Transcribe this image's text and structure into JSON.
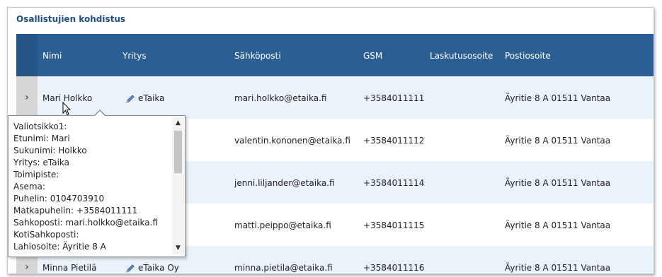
{
  "panel": {
    "title": "Osallistujien kohdistus"
  },
  "columns": [
    "Nimi",
    "Yritys",
    "Sähköposti",
    "GSM",
    "Laskutusosoite",
    "Postiosoite"
  ],
  "rows": [
    {
      "name": "Mari Holkko",
      "company": "eTaika",
      "email": "mari.holkko@etaika.fi",
      "gsm": "+3584011111",
      "billing": "",
      "postal": "Äyritie 8 A 01511 Vantaa"
    },
    {
      "name": "",
      "company": "",
      "email": "valentin.kononen@etaika.fi",
      "gsm": "+3584011112",
      "billing": "",
      "postal": "Äyritie 8 A 01511 Vantaa"
    },
    {
      "name": "",
      "company": "",
      "email": "jenni.liljander@etaika.fi",
      "gsm": "+3584011114",
      "billing": "",
      "postal": "Äyritie 8 A 01511 Vantaa"
    },
    {
      "name": "",
      "company": "",
      "email": "matti.peippo@etaika.fi",
      "gsm": "+3584011115",
      "billing": "",
      "postal": "Äyritie 8 A 01511 Vantaa"
    },
    {
      "name": "Minna Pietilä",
      "company": "eTaika Oy",
      "email": "minna.pietila@etaika.fi",
      "gsm": "+3584011116",
      "billing": "",
      "postal": "Äyritie 8 A 01511 Vantaa"
    }
  ],
  "expander_icon": "›",
  "tooltip": {
    "lines": [
      "Valiotsikko1:",
      "Etunimi: Mari",
      "Sukunimi: Holkko",
      "Yritys: eTaika",
      "Toimipiste:",
      "Asema:",
      "Puhelin: 0104703910",
      "Matkapuhelin: +3584011111",
      "Sahkoposti: mari.holkko@etaika.fi",
      "KotiSahkoposti:",
      "Lahiosoite: Äyritie 8 A"
    ],
    "scroll_up_icon": "▲",
    "scroll_down_icon": "▼"
  },
  "colors": {
    "header": "#2b5f93",
    "title": "#1f4f85",
    "row_alt": "#eaf3fc",
    "expander": "#d6d6d6"
  }
}
